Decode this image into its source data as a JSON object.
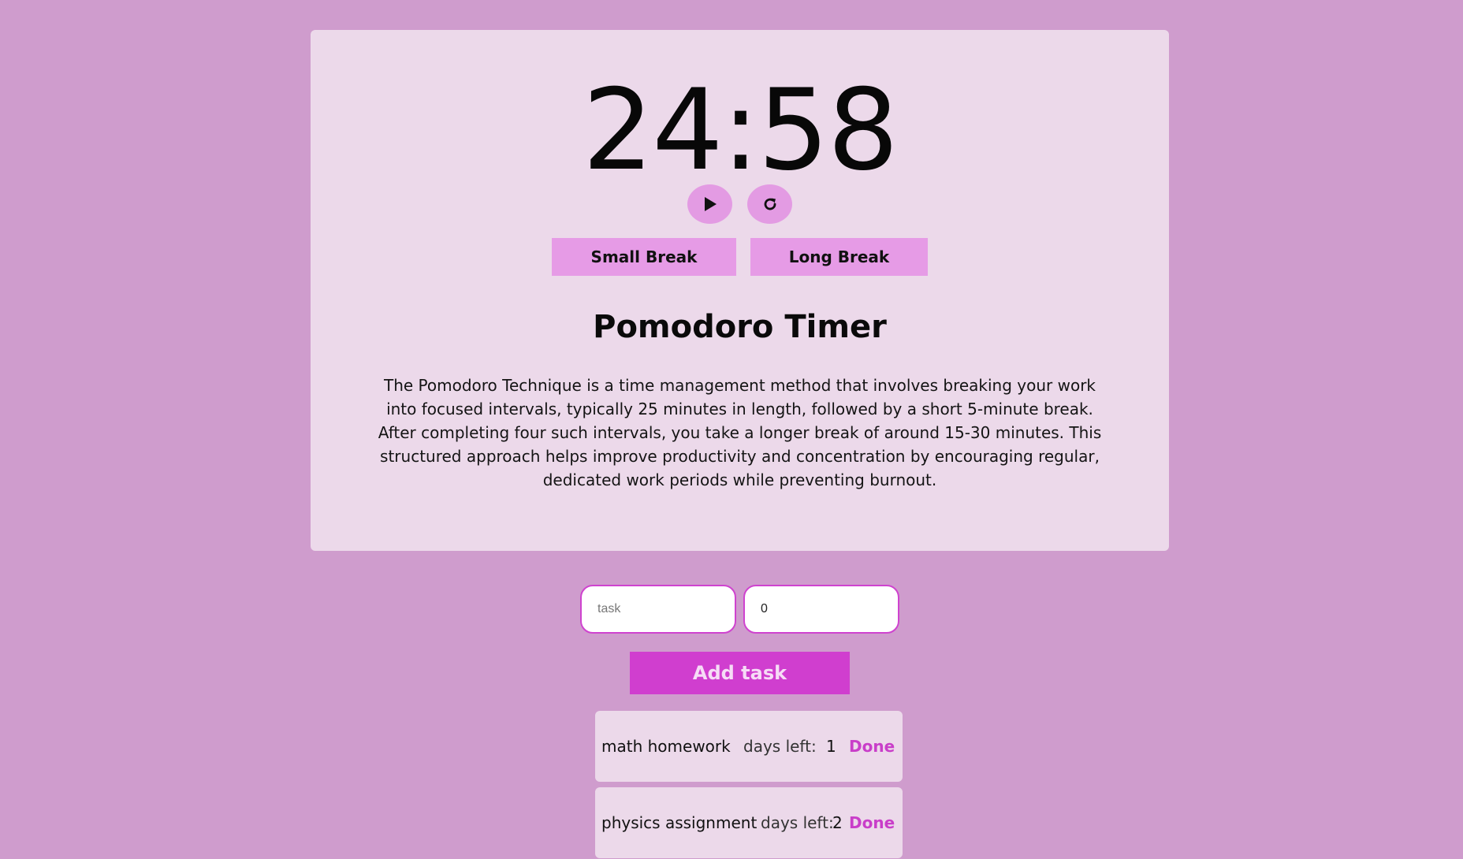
{
  "timer": {
    "time": "24:58",
    "play_icon": "play-icon",
    "reset_icon": "refresh-icon"
  },
  "breaks": {
    "small_label": "Small Break",
    "long_label": "Long Break"
  },
  "info": {
    "title": "Pomodoro Timer",
    "description": "The Pomodoro Technique is a time management method that involves breaking your work into focused intervals, typically 25 minutes in length, followed by a short 5-minute break. After completing four such intervals, you take a longer break of around 15-30 minutes. This structured approach helps improve productivity and concentration by encouraging regular, dedicated work periods while preventing burnout."
  },
  "form": {
    "task_placeholder": "task",
    "task_value": "",
    "days_value": "0",
    "add_label": "Add task"
  },
  "tasks": [
    {
      "name": "math homework",
      "days_label": "days left:",
      "days": "1",
      "done_label": "Done"
    },
    {
      "name": "physics assignment",
      "days_label": "days left:",
      "days": "2",
      "done_label": "Done"
    }
  ],
  "colors": {
    "background": "#cf9ccd",
    "card": "#ecd9ea",
    "button": "#e69be6",
    "accent": "#d03ecf"
  }
}
